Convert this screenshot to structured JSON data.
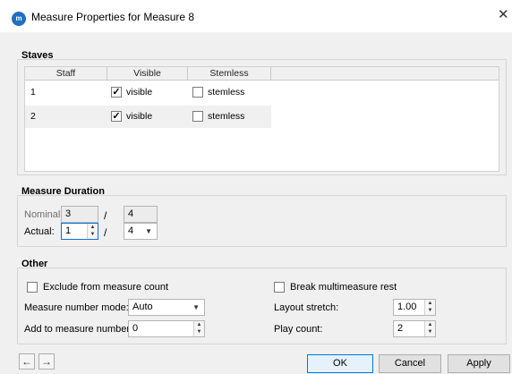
{
  "window": {
    "title": "Measure Properties for Measure 8",
    "icon": "musescore-app-icon"
  },
  "staves": {
    "title": "Staves",
    "columns": [
      "Staff",
      "Visible",
      "Stemless"
    ],
    "rows": [
      {
        "staff": "1",
        "visible": true,
        "visible_label": "visible",
        "stemless": false,
        "stemless_label": "stemless"
      },
      {
        "staff": "2",
        "visible": true,
        "visible_label": "visible",
        "stemless": false,
        "stemless_label": "stemless"
      }
    ]
  },
  "duration": {
    "title": "Measure Duration",
    "nominal_label": "Nominal:",
    "nominal_num": "3",
    "nominal_den": "4",
    "actual_label": "Actual:",
    "actual_num": "1",
    "actual_den": "4",
    "slash": "/"
  },
  "other": {
    "title": "Other",
    "exclude_label": "Exclude from measure count",
    "exclude_checked": false,
    "break_label": "Break multimeasure rest",
    "break_checked": false,
    "mode_label": "Measure number mode:",
    "mode_value": "Auto",
    "add_label": "Add to measure number:",
    "add_value": "0",
    "stretch_label": "Layout stretch:",
    "stretch_value": "1.00",
    "play_label": "Play count:",
    "play_value": "2"
  },
  "buttons": {
    "ok": "OK",
    "cancel": "Cancel",
    "apply": "Apply"
  },
  "nav": {
    "prev_icon": "arrow-left-icon",
    "next_icon": "arrow-right-icon"
  },
  "colors": {
    "accent": "#0078d7",
    "app_icon": "#1f6fc5"
  }
}
